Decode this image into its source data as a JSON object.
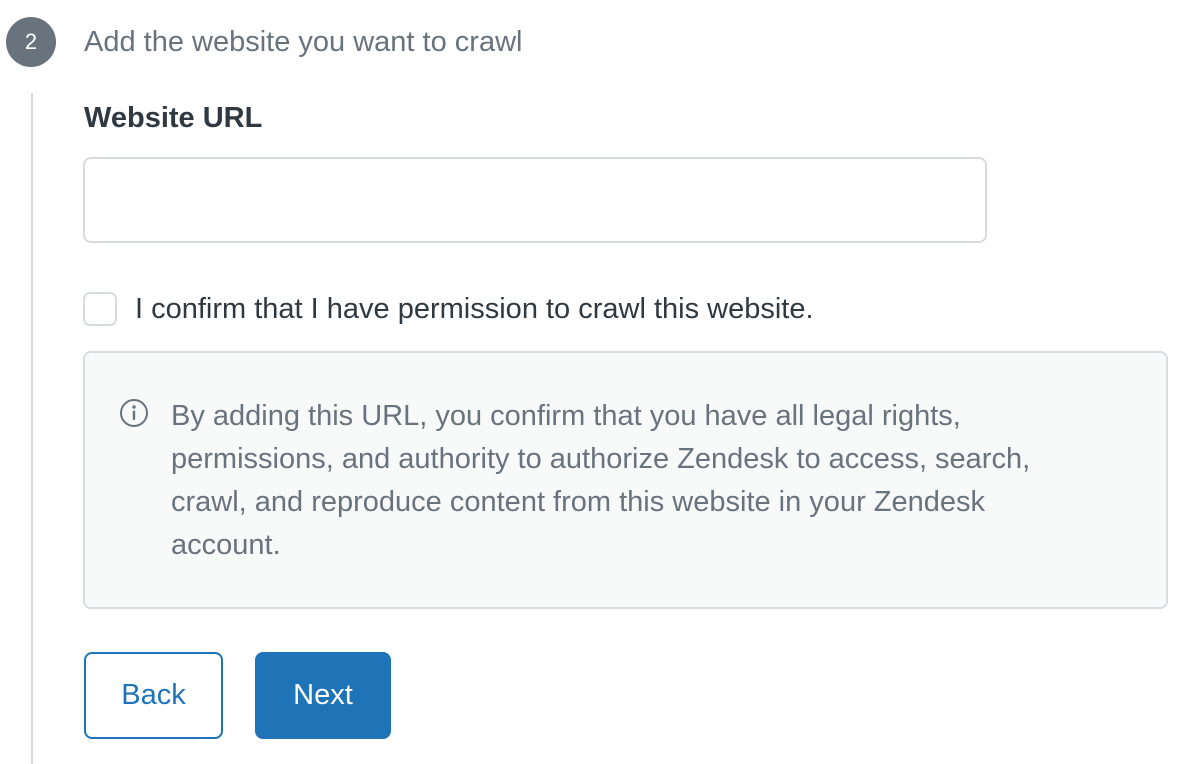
{
  "step": {
    "number": "2",
    "title": "Add the website you want to crawl"
  },
  "url_field": {
    "label": "Website URL",
    "value": "",
    "placeholder": ""
  },
  "permission_checkbox": {
    "label": "I confirm that I have permission to crawl this website.",
    "checked": false
  },
  "notice": {
    "icon": "info-icon",
    "text": "By adding this URL, you confirm that you have all legal rights, permissions, and authority to authorize Zendesk to access, search, crawl, and reproduce content from this website in your Zendesk account."
  },
  "buttons": {
    "back_label": "Back",
    "next_label": "Next"
  },
  "colors": {
    "primary": "#1f73b7",
    "step_badge": "#68737d",
    "border": "#d8dcde",
    "notice_bg": "#f8f9f9"
  }
}
